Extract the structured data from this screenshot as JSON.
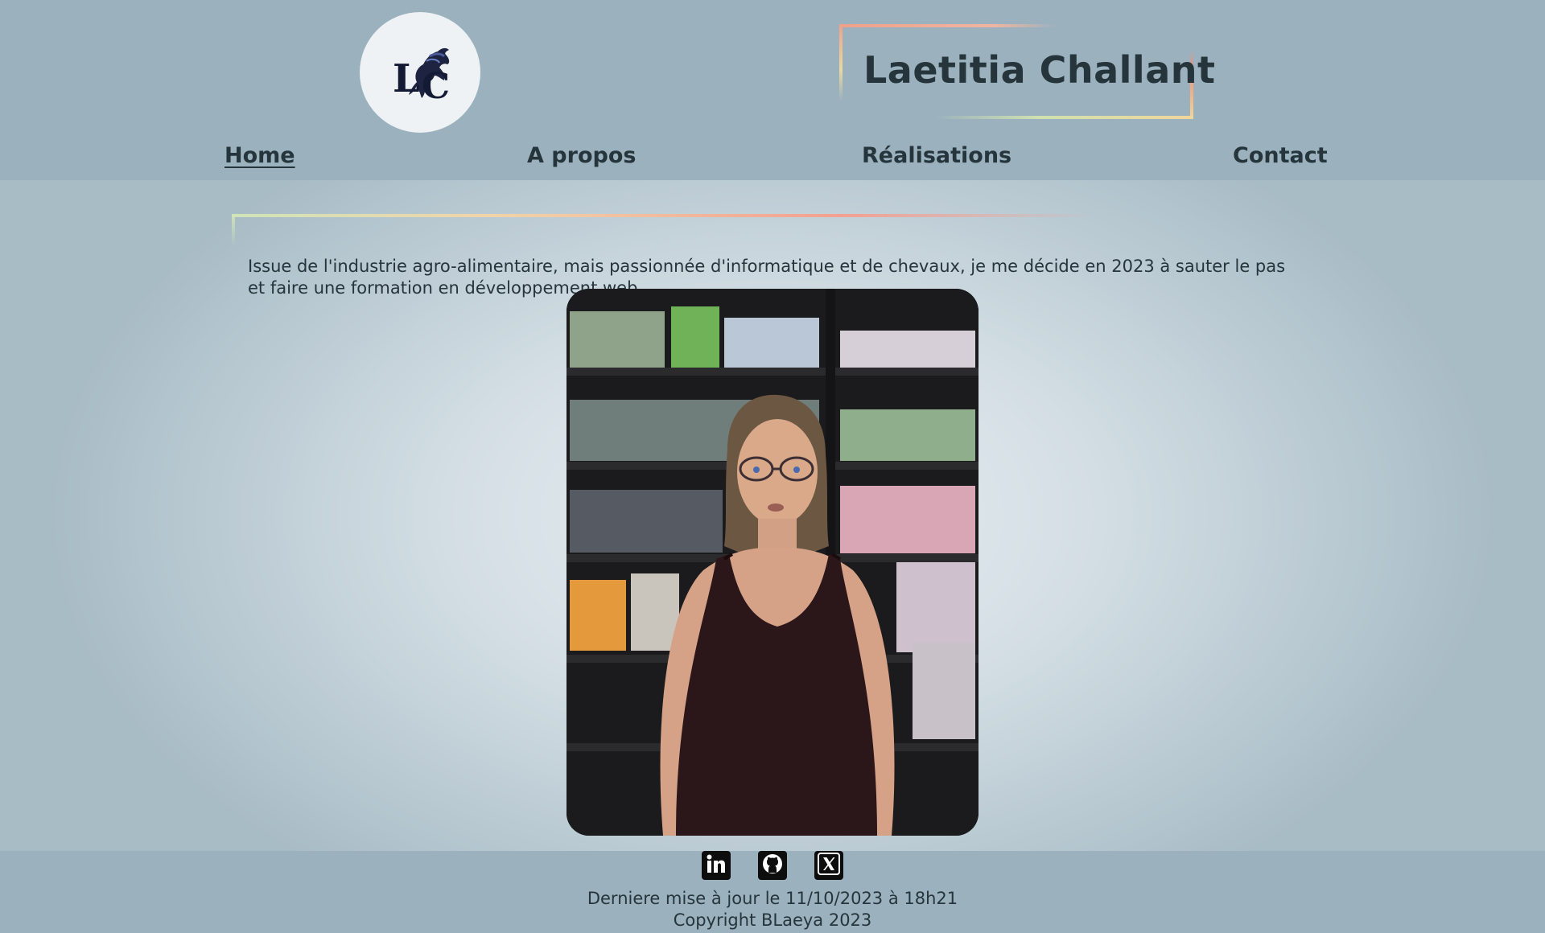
{
  "header": {
    "logo_text": "LC",
    "site_title": "Laetitia Challant"
  },
  "nav": {
    "items": [
      {
        "label": "Home",
        "active": true
      },
      {
        "label": "A propos",
        "active": false
      },
      {
        "label": "Réalisations",
        "active": false
      },
      {
        "label": "Contact",
        "active": false
      }
    ]
  },
  "main": {
    "intro_text": "Issue de l'industrie agro-alimentaire, mais passionnée d'informatique et de chevaux, je me décide en 2023 à sauter le pas et faire une formation en développement web.",
    "photo_icon": "portrait-photo"
  },
  "footer": {
    "social": [
      {
        "name": "linkedin-icon"
      },
      {
        "name": "github-icon"
      },
      {
        "name": "x-icon"
      }
    ],
    "last_update": "Derniere mise à jour le 11/10/2023 à 18h21",
    "copyright": "Copyright BLaeya 2023"
  },
  "colors": {
    "background": "#9bb2be",
    "text": "#25353b",
    "accent_coral": "#f0907c",
    "accent_yellow": "#f1d69a",
    "accent_green": "#cfe4b8"
  }
}
